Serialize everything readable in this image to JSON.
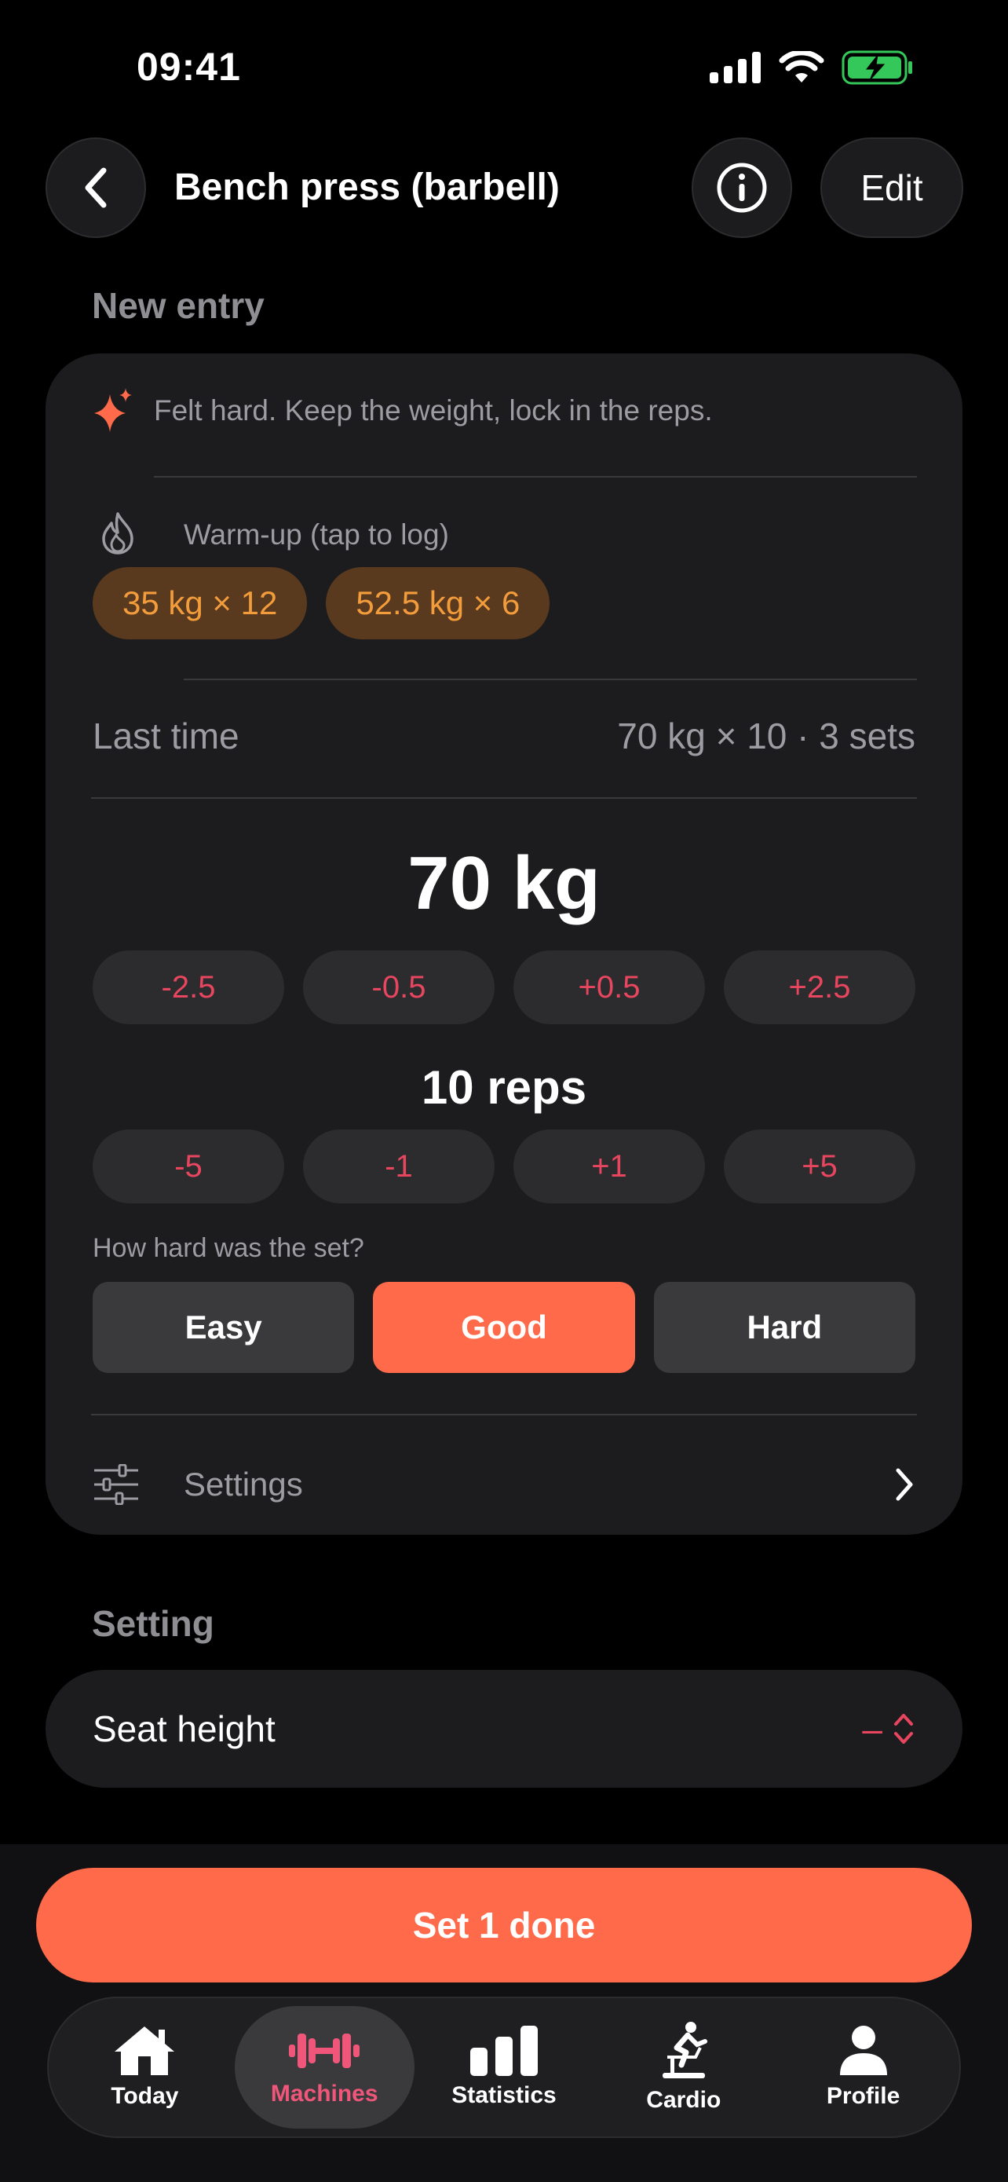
{
  "status_bar": {
    "time": "09:41"
  },
  "header": {
    "title": "Bench press (barbell)",
    "edit_label": "Edit"
  },
  "sections": {
    "new_entry": "New entry",
    "setting": "Setting"
  },
  "entry": {
    "ai_hint": "Felt hard. Keep the weight, lock in the reps.",
    "warmup_label": "Warm-up (tap to log)",
    "warmup_chips": [
      "35 kg × 12",
      "52.5 kg × 6"
    ],
    "last_time_label": "Last time",
    "last_time_value": "70 kg × 10 · 3 sets",
    "weight": "70 kg",
    "weight_steps": [
      "-2.5",
      "-0.5",
      "+0.5",
      "+2.5"
    ],
    "reps": "10 reps",
    "rep_steps": [
      "-5",
      "-1",
      "+1",
      "+5"
    ],
    "effort_question": "How hard was the set?",
    "effort_options": [
      "Easy",
      "Good",
      "Hard"
    ],
    "effort_selected": "Good",
    "settings_label": "Settings"
  },
  "setting": {
    "label": "Seat height",
    "value": "–"
  },
  "done_button": "Set 1 done",
  "tabs": [
    {
      "label": "Today",
      "icon": "home-icon"
    },
    {
      "label": "Machines",
      "icon": "dumbbell-icon",
      "active": true
    },
    {
      "label": "Statistics",
      "icon": "bar-chart-icon"
    },
    {
      "label": "Cardio",
      "icon": "bike-icon"
    },
    {
      "label": "Profile",
      "icon": "person-icon"
    }
  ],
  "colors": {
    "accent": "#ff6b4a",
    "pink": "#e8455f",
    "warmup_chip_bg": "#5a3a1e",
    "warmup_chip_text": "#f39c3c",
    "battery": "#34c759"
  }
}
